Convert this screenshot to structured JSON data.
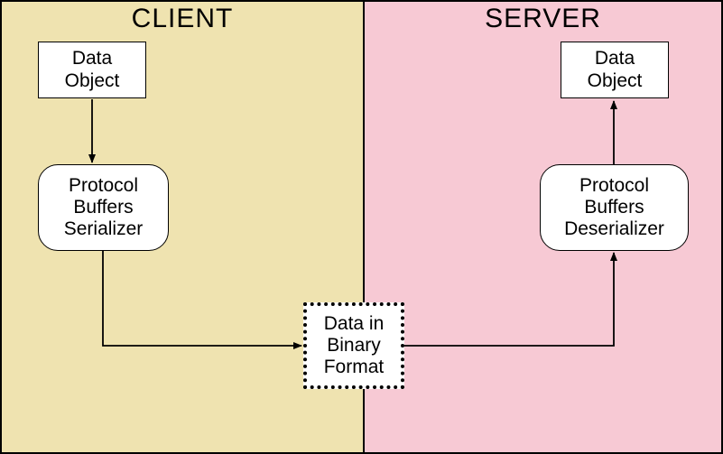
{
  "client": {
    "title": "CLIENT",
    "data_object": "Data\nObject",
    "serializer": "Protocol\nBuffers\nSerializer"
  },
  "server": {
    "title": "SERVER",
    "data_object": "Data\nObject",
    "deserializer": "Protocol\nBuffers\nDeserializer"
  },
  "middle": {
    "binary": "Data in\nBinary\nFormat"
  }
}
